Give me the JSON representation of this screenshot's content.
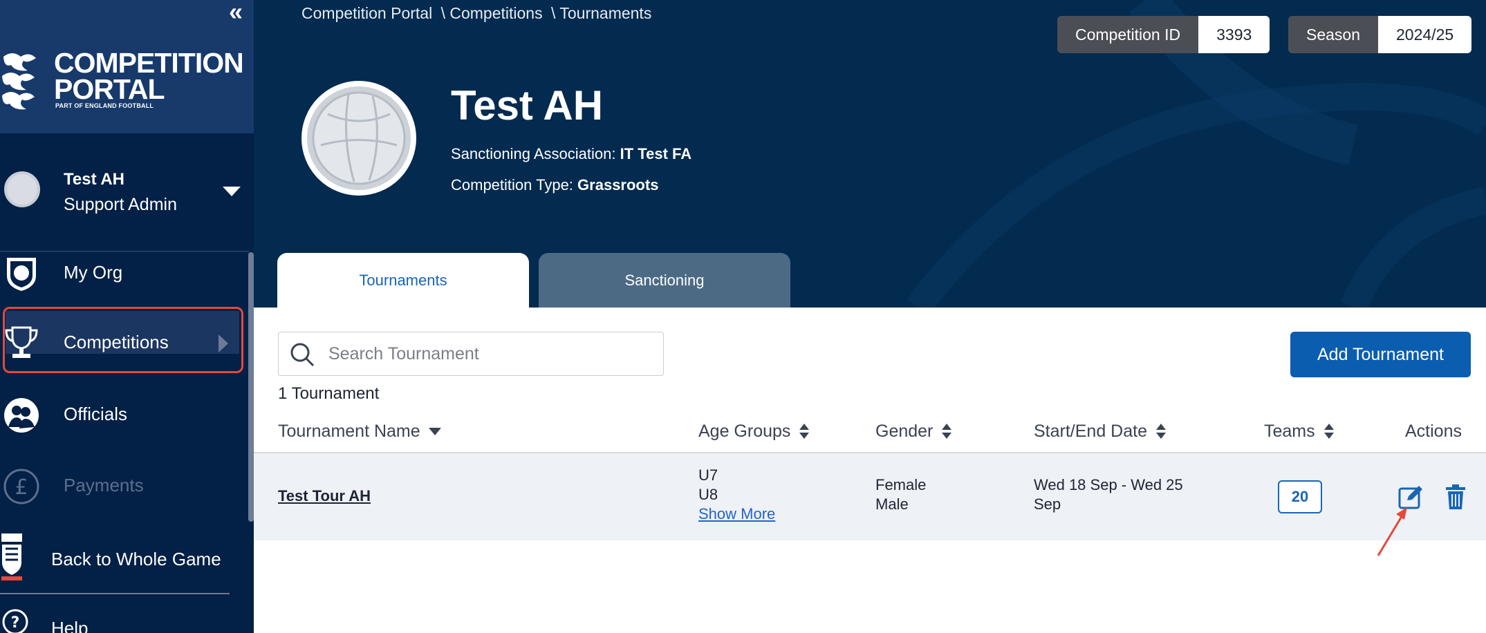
{
  "sidebar": {
    "brand": {
      "line1": "COMPETITION",
      "line2": "PORTAL",
      "sub": "PART OF ENGLAND FOOTBALL"
    },
    "user": {
      "name": "Test AH",
      "role": "Support Admin"
    },
    "items": [
      {
        "label": "My Org",
        "icon": "shield-icon"
      },
      {
        "label": "Competitions",
        "icon": "trophy-icon",
        "active": true
      },
      {
        "label": "Officials",
        "icon": "people-icon"
      },
      {
        "label": "Payments",
        "icon": "pound-icon",
        "disabled": true
      }
    ],
    "back_label": "Back to Whole Game",
    "help_label": "Help"
  },
  "breadcrumb": [
    "Competition Portal",
    "\\ Competitions",
    "\\ Tournaments"
  ],
  "badges": {
    "competition_id": {
      "label": "Competition ID",
      "value": "3393"
    },
    "season": {
      "label": "Season",
      "value": "2024/25"
    }
  },
  "competition": {
    "title": "Test AH",
    "sanctioning_label": "Sanctioning Association:",
    "sanctioning_value": "IT Test FA",
    "type_label": "Competition Type:",
    "type_value": "Grassroots"
  },
  "tabs": [
    {
      "label": "Tournaments",
      "active": true
    },
    {
      "label": "Sanctioning",
      "active": false
    }
  ],
  "search": {
    "placeholder": "Search Tournament",
    "value": ""
  },
  "add_button": "Add Tournament",
  "count_text": "1 Tournament",
  "table": {
    "headers": {
      "name": "Tournament Name",
      "age": "Age Groups",
      "gender": "Gender",
      "dates": "Start/End Date",
      "teams": "Teams",
      "actions": "Actions"
    },
    "rows": [
      {
        "name": "Test Tour AH",
        "age_groups": [
          "U7",
          "U8"
        ],
        "show_more": "Show More",
        "genders": [
          "Female",
          "Male"
        ],
        "dates_line1": "Wed 18 Sep - Wed 25",
        "dates_line2": "Sep",
        "teams": "20"
      }
    ]
  },
  "colors": {
    "sidebar": "#032046",
    "header": "#032a4f",
    "primary": "#0b5db0",
    "highlight": "#e24a3b"
  }
}
